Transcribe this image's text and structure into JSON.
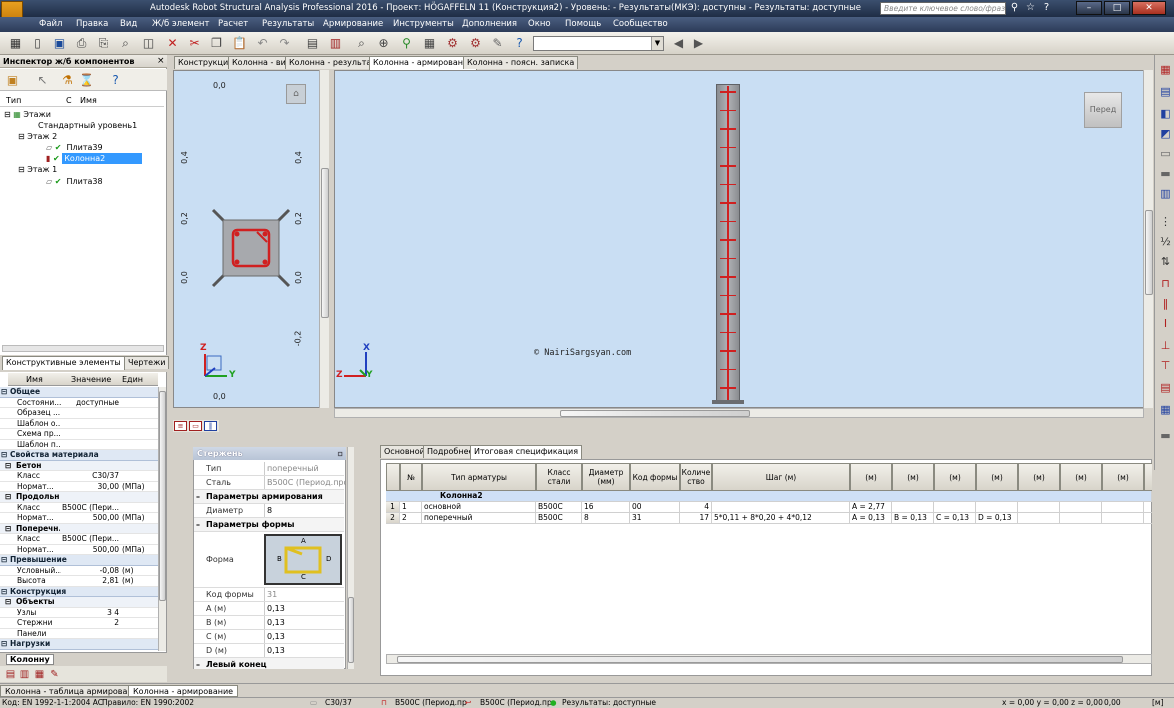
{
  "app": {
    "title": "Autodesk Robot Structural Analysis Professional 2016 - Проект: HÖGAFFELN 11 (Конструкция2) - Уровень: - Результаты(МКЭ): доступны - Результаты: доступные",
    "logo_text": "PRO",
    "search_placeholder": "Введите ключевое слово/фразу"
  },
  "menu": [
    "Файл",
    "Правка",
    "Вид",
    "Ж/б элемент",
    "Расчет",
    "Результаты",
    "Армирование",
    "Инструменты",
    "Дополнения",
    "Окно",
    "Помощь",
    "Сообщество"
  ],
  "inspector": {
    "title": "Инспектор ж/б компонентов",
    "close": "×",
    "columns": [
      "Тип",
      "С",
      "Имя"
    ],
    "tree": [
      {
        "label": "Этажи",
        "check": ""
      },
      {
        "label": "Стандартный уровень1",
        "check": ""
      },
      {
        "label": "Этаж 2",
        "check": ""
      },
      {
        "label": "Плита39",
        "check": "✔"
      },
      {
        "label": "Колонна2",
        "check": "✔"
      },
      {
        "label": "Этаж 1",
        "check": ""
      },
      {
        "label": "Плита38",
        "check": "✔"
      }
    ],
    "tabs": [
      "Конструктивные элементы",
      "Чертежи"
    ]
  },
  "props": {
    "headers": [
      "Имя",
      "Значение",
      "Един"
    ],
    "rows": [
      {
        "kind": "sect",
        "name": "Общее",
        "value": "",
        "unit": ""
      },
      {
        "kind": "row",
        "name": "Состояни...",
        "value": "доступные",
        "unit": ""
      },
      {
        "kind": "row",
        "name": "Образец ...",
        "value": "",
        "unit": ""
      },
      {
        "kind": "row",
        "name": "Шаблон о...",
        "value": "",
        "unit": ""
      },
      {
        "kind": "row",
        "name": "Схема пр...",
        "value": "",
        "unit": ""
      },
      {
        "kind": "row",
        "name": "Шаблон п...",
        "value": "",
        "unit": ""
      },
      {
        "kind": "sect",
        "name": "Свойства материала",
        "value": "",
        "unit": ""
      },
      {
        "kind": "sub",
        "name": "Бетон",
        "value": "",
        "unit": ""
      },
      {
        "kind": "row",
        "name": "Класс",
        "value": "C30/37",
        "unit": ""
      },
      {
        "kind": "row",
        "name": "Нормат...",
        "value": "30,00",
        "unit": "(МПа)"
      },
      {
        "kind": "sub",
        "name": "Продольн...",
        "value": "",
        "unit": ""
      },
      {
        "kind": "row",
        "name": "Класс",
        "value": "B500C (Пери...",
        "unit": ""
      },
      {
        "kind": "row",
        "name": "Нормат...",
        "value": "500,00",
        "unit": "(МПа)"
      },
      {
        "kind": "sub",
        "name": "Поперечн...",
        "value": "",
        "unit": ""
      },
      {
        "kind": "row",
        "name": "Класс",
        "value": "B500C (Пери...",
        "unit": ""
      },
      {
        "kind": "row",
        "name": "Нормат...",
        "value": "500,00",
        "unit": "(МПа)"
      },
      {
        "kind": "sect",
        "name": "Превышение",
        "value": "",
        "unit": ""
      },
      {
        "kind": "row",
        "name": "Условный...",
        "value": "-0,08",
        "unit": "(м)"
      },
      {
        "kind": "row",
        "name": "Высота",
        "value": "2,81",
        "unit": "(м)"
      },
      {
        "kind": "sect",
        "name": "Конструкция",
        "value": "",
        "unit": ""
      },
      {
        "kind": "sub",
        "name": "Объекты",
        "value": "",
        "unit": ""
      },
      {
        "kind": "row",
        "name": "Узлы",
        "value": "3 4",
        "unit": ""
      },
      {
        "kind": "row",
        "name": "Стержни",
        "value": "2",
        "unit": ""
      },
      {
        "kind": "row",
        "name": "Панели",
        "value": "",
        "unit": ""
      },
      {
        "kind": "sect",
        "name": "Нагрузки",
        "value": "",
        "unit": ""
      }
    ],
    "bottom_tab": "Колонну"
  },
  "doc_tabs": [
    "Конструкция",
    "Колонна - вид",
    "Колонна - результаты",
    "Колонна - армирование",
    "Колонна - поясн. записка"
  ],
  "section_view": {
    "top_label": "0,0",
    "bottom_label": "0,0",
    "left_labels": [
      "0,4",
      "0,2",
      "0,0"
    ],
    "right_labels": [
      "0,4",
      "0,2",
      "0,0",
      "-0,2"
    ],
    "axis_z": "Z",
    "axis_y": "Y"
  },
  "elevation_view": {
    "copyright": "© NairiSargsyan.com",
    "viewcube": "Перед",
    "axis_x": "X",
    "axis_z": "Z",
    "axis_y": "Y"
  },
  "bar_props": {
    "title": "Стержень",
    "rows": [
      {
        "kind": "row",
        "key": "Тип",
        "value": "поперечный"
      },
      {
        "kind": "row",
        "key": "Сталь",
        "value": "B500C (Период.про..."
      },
      {
        "kind": "bold",
        "key": "Параметры армирования",
        "value": ""
      },
      {
        "kind": "row",
        "key": "Диаметр",
        "value": "8"
      },
      {
        "kind": "bold",
        "key": "Параметры формы",
        "value": ""
      },
      {
        "kind": "shape",
        "key": "Форма",
        "value": ""
      },
      {
        "kind": "row",
        "key": "Код формы",
        "value": "31"
      },
      {
        "kind": "row",
        "key": "A (м)",
        "value": "0,13"
      },
      {
        "kind": "row",
        "key": "B (м)",
        "value": "0,13"
      },
      {
        "kind": "row",
        "key": "C (м)",
        "value": "0,13"
      },
      {
        "kind": "row",
        "key": "D (м)",
        "value": "0,13"
      },
      {
        "kind": "bold",
        "key": "Левый конец",
        "value": ""
      }
    ],
    "shape_labels": {
      "a": "A",
      "b": "B",
      "c": "C",
      "d": "D"
    }
  },
  "spec": {
    "tabs": [
      "Основной",
      "Подробнее",
      "Итоговая спецификация"
    ],
    "headers": [
      "№",
      "Тип арматуры",
      "Класс стали",
      "Диаметр (мм)",
      "Код формы",
      "Количе ство",
      "Шаг (м)",
      "(м)",
      "(м)",
      "(м)",
      "(м)",
      "(м)",
      "(м)",
      "(м)",
      "(м)"
    ],
    "group": "Колонна2",
    "rows": [
      {
        "idx": "1",
        "no": "1",
        "type": "основной",
        "cls": "B500C",
        "dia": "16",
        "code": "00",
        "qty": "4",
        "step": "",
        "d1": "A = 2,77",
        "d2": "",
        "d3": "",
        "d4": ""
      },
      {
        "idx": "2",
        "no": "2",
        "type": "поперечный",
        "cls": "B500C",
        "dia": "8",
        "code": "31",
        "qty": "17",
        "step": "5*0,11 + 8*0,20 + 4*0,12",
        "d1": "A = 0,13",
        "d2": "B = 0,13",
        "d3": "C = 0,13",
        "d4": "D = 0,13"
      }
    ]
  },
  "bottom_tabs": [
    "Колонна - таблица армирования",
    "Колонна - армирование"
  ],
  "status": {
    "code": "Код: EN 1992-1-1:2004 AC",
    "rule": "Правило: EN 1990:2002",
    "concrete": "C30/37",
    "steel1": "B500C (Период.пр",
    "steel2": "B500C (Период.пр",
    "results": "Результаты: доступные",
    "coords": "x = 0,00 y = 0,00 z = 0,00",
    "angle": "0,00",
    "unit": "[м]"
  },
  "colors": {
    "accent_select": "#3399ff",
    "rebar": "#d02020",
    "viewport": "#c9def3"
  }
}
